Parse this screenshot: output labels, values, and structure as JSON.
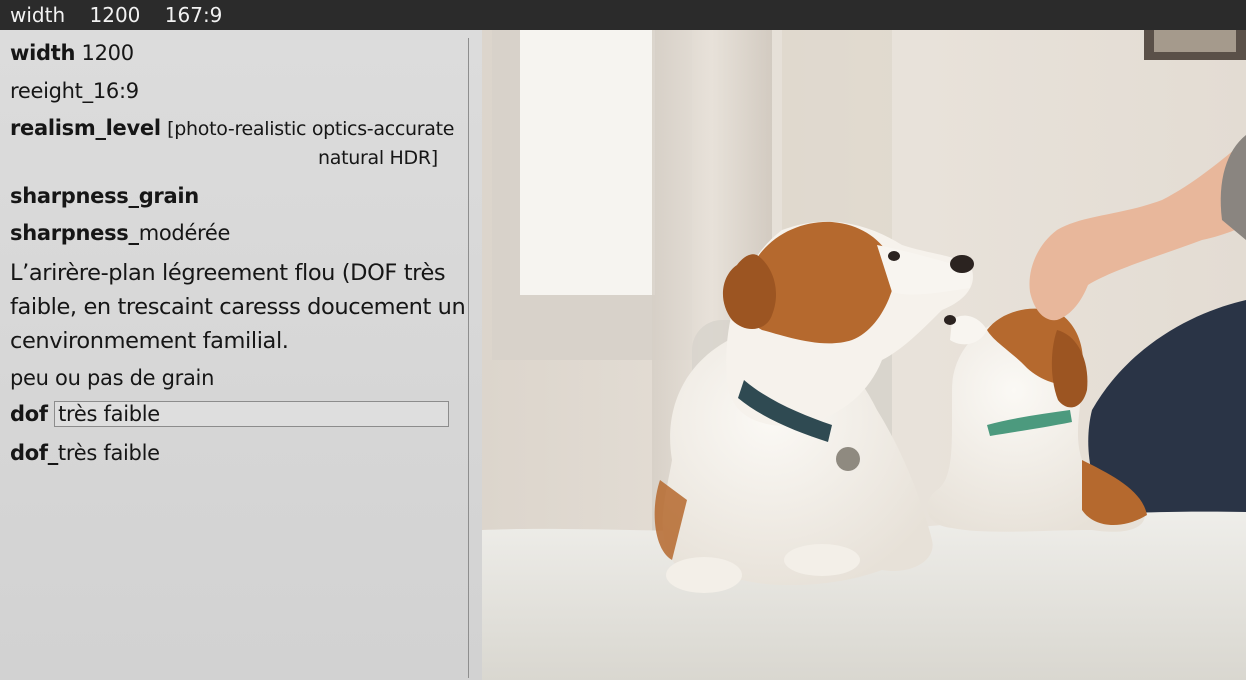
{
  "topbar": {
    "items": [
      "width",
      "1200",
      "167:9"
    ]
  },
  "panel": {
    "width_key": "width",
    "width_value": "1200",
    "height_line": "reeight_16:9",
    "realism_key": "realism_level",
    "realism_value_1": "[photo-realistic   optics-accurate",
    "realism_value_2": "natural HDR]",
    "sharpness_grain": "sharpness_grain",
    "sharpness_key": "sharpness_",
    "sharpness_value": "modérée",
    "description": [
      "L’arirère-plan légreement flou (DOF très",
      "faible, en trescaint caresss doucement un",
      "cenvironmement familial."
    ],
    "grain_line": "peu ou pas de grain",
    "dof_key": "dof",
    "dof_field_value": "très faible",
    "dof2_key": "dof_",
    "dof2_value": "très faible"
  },
  "photo": {
    "subject": "two dogs on a sofa with a hand petting the puppy",
    "colors": {
      "wall": "#e6ded4",
      "window": "#f4f1ec",
      "sofa": "#ecebe6",
      "dog_white": "#f7f4ef",
      "dog_brown": "#b5692e",
      "collar_big": "#2f4a52",
      "collar_small": "#4c9a7e",
      "jeans": "#2a3446",
      "skin": "#e8b79b"
    }
  }
}
